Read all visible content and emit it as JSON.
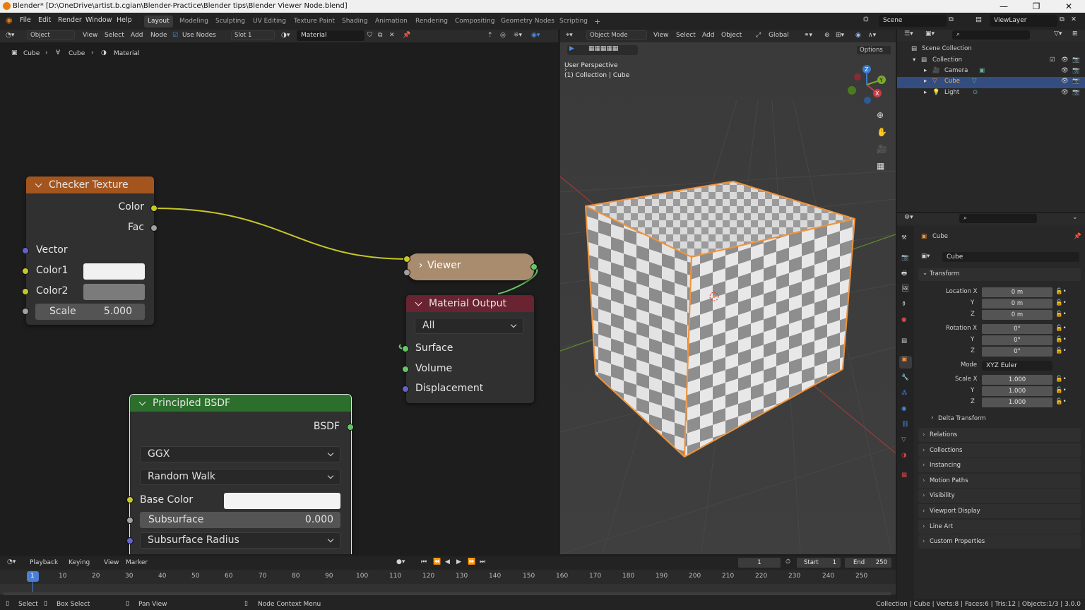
{
  "window": {
    "title": "Blender* [D:\\OneDrive\\artist.b.cgian\\Blender-Practice\\Blender tips\\Blender Viewer Node.blend]",
    "min": "—",
    "max": "❐",
    "close": "✕"
  },
  "menu": {
    "items": [
      "File",
      "Edit",
      "Render",
      "Window",
      "Help"
    ],
    "workspaces": [
      "Layout",
      "Modeling",
      "Sculpting",
      "UV Editing",
      "Texture Paint",
      "Shading",
      "Animation",
      "Rendering",
      "Compositing",
      "Geometry Nodes",
      "Scripting",
      "+"
    ],
    "active_workspace": "Layout",
    "scene": "Scene",
    "view_layer": "ViewLayer"
  },
  "node_editor": {
    "header": {
      "editor_type": "Object",
      "menus": [
        "View",
        "Select",
        "Add",
        "Node"
      ],
      "use_nodes": "Use Nodes",
      "slot": "Slot 1",
      "material": "Material"
    },
    "breadcrumb": [
      "Cube",
      "Cube",
      "Material"
    ],
    "checker": {
      "title": "Checker Texture",
      "out_color": "Color",
      "out_fac": "Fac",
      "vector": "Vector",
      "color1": "Color1",
      "color2": "Color2",
      "scale_label": "Scale",
      "scale_value": "5.000",
      "color1_hex": "#f1f1f1",
      "color2_hex": "#7b7b7b"
    },
    "viewer": {
      "title": "Viewer"
    },
    "output": {
      "title": "Material Output",
      "target": "All",
      "surface": "Surface",
      "volume": "Volume",
      "displacement": "Displacement"
    },
    "bsdf": {
      "title": "Principled BSDF",
      "out": "BSDF",
      "distribution": "GGX",
      "subsurface_method": "Random Walk",
      "base_color": "Base Color",
      "subsurface": "Subsurface",
      "subsurface_value": "0.000",
      "subsurface_radius": "Subsurface Radius",
      "base_color_hex": "#f3f3f3"
    }
  },
  "viewport": {
    "header": {
      "mode": "Object Mode",
      "menus": [
        "View",
        "Select",
        "Add",
        "Object"
      ],
      "transform": "Global"
    },
    "options": "Options",
    "info_line1": "User Perspective",
    "info_line2": "(1) Collection | Cube",
    "gizmo": {
      "x": "X",
      "y": "Y",
      "z": "Z"
    }
  },
  "outliner": {
    "root": "Scene Collection",
    "collection": "Collection",
    "items": [
      "Camera",
      "Cube",
      "Light"
    ],
    "selected": "Cube"
  },
  "properties": {
    "object_name": "Cube",
    "data_name": "Cube",
    "transform": {
      "title": "Transform",
      "location": {
        "label": "Location X",
        "x": "0 m",
        "y": "0 m",
        "z": "0 m"
      },
      "rotation": {
        "label": "Rotation X",
        "x": "0°",
        "y": "0°",
        "z": "0°"
      },
      "mode_label": "Mode",
      "mode": "XYZ Euler",
      "scale": {
        "label": "Scale X",
        "x": "1.000",
        "y": "1.000",
        "z": "1.000"
      },
      "axis_y": "Y",
      "axis_z": "Z",
      "delta": "Delta Transform"
    },
    "panels": [
      "Relations",
      "Collections",
      "Instancing",
      "Motion Paths",
      "Visibility",
      "Viewport Display",
      "Line Art",
      "Custom Properties"
    ]
  },
  "timeline": {
    "menus": [
      "Playback",
      "Keying",
      "View",
      "Marker"
    ],
    "current_frame": "1",
    "start_label": "Start",
    "start": "1",
    "end_label": "End",
    "end": "250",
    "ticks": [
      "1",
      "10",
      "20",
      "30",
      "40",
      "50",
      "60",
      "70",
      "80",
      "90",
      "100",
      "110",
      "120",
      "130",
      "140",
      "150",
      "160",
      "170",
      "180",
      "190",
      "200",
      "210",
      "220",
      "230",
      "240",
      "250"
    ]
  },
  "statusbar": {
    "select": "Select",
    "box_select": "Box Select",
    "pan_view": "Pan View",
    "context_menu": "Node Context Menu",
    "stats": "Collection | Cube | Verts:8 | Faces:6 | Tris:12 | Objects:1/3 | 3.0.0"
  },
  "colors": {
    "accent": "#e87d0d",
    "select_blue": "#334d80",
    "checker_header": "#a4551e",
    "viewer_header": "#a98c6e",
    "output_header": "#6a2331",
    "bsdf_header": "#2c6e2c"
  }
}
